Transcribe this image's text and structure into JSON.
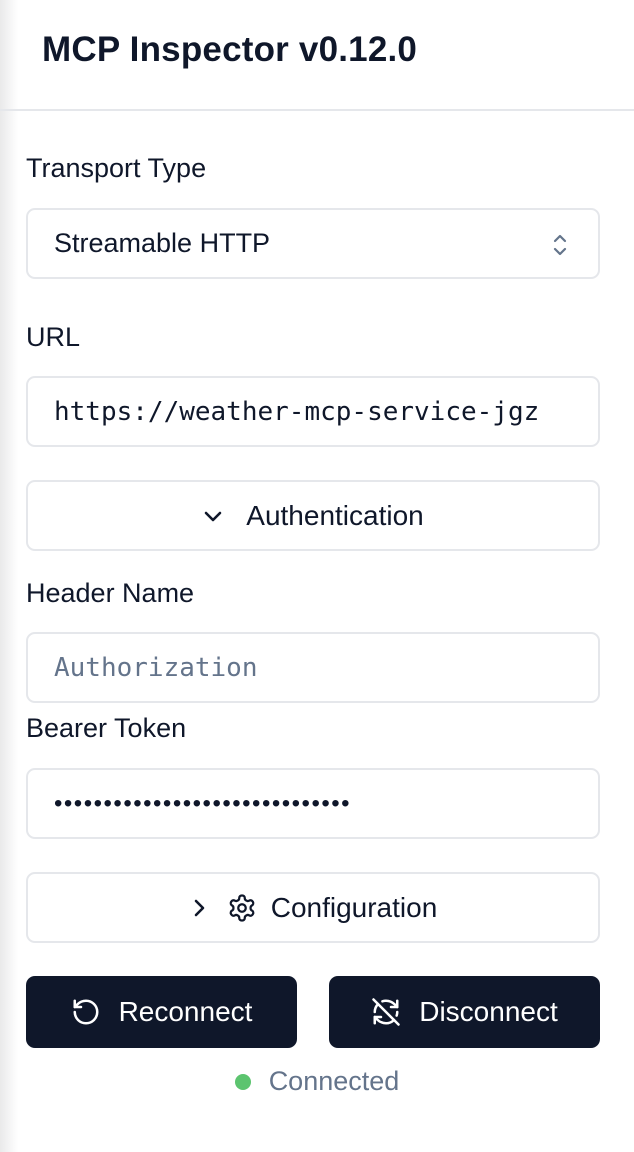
{
  "header": {
    "title": "MCP Inspector v0.12.0"
  },
  "transport": {
    "label": "Transport Type",
    "selected": "Streamable HTTP"
  },
  "url": {
    "label": "URL",
    "value": "https://weather-mcp-service-jgz"
  },
  "authentication": {
    "toggle_label": "Authentication",
    "header_name_label": "Header Name",
    "header_name_placeholder": "Authorization",
    "bearer_token_label": "Bearer Token",
    "bearer_token_masked": "••••••••••••••••••••••••••••••"
  },
  "configuration": {
    "toggle_label": "Configuration"
  },
  "actions": {
    "reconnect_label": "Reconnect",
    "disconnect_label": "Disconnect"
  },
  "status": {
    "text": "Connected",
    "color": "#5cc46f"
  },
  "colors": {
    "primary_dark": "#0f172a",
    "border": "#e5e7eb",
    "muted_text": "#64748b"
  }
}
